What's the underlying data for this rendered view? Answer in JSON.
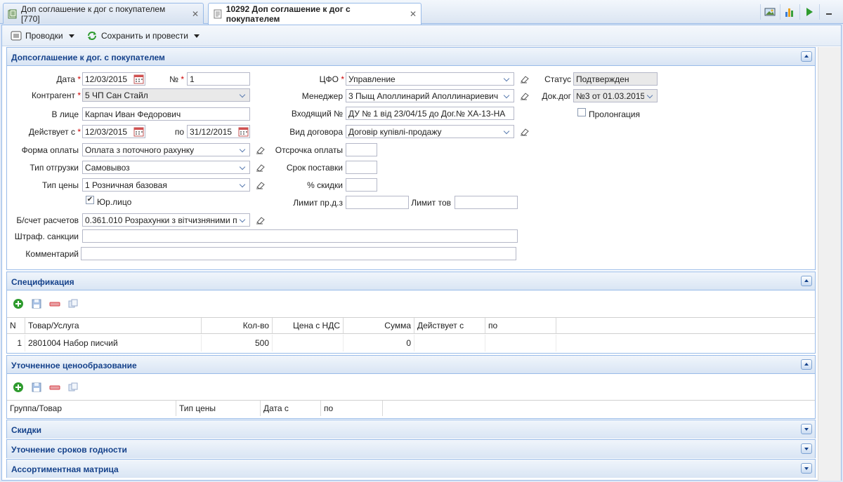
{
  "tabs": [
    {
      "label": "Доп соглашение к дог с покупателем [770]"
    },
    {
      "label": "10292 Доп соглашение к дог с покупателем"
    }
  ],
  "toolbar": {
    "postings": "Проводки",
    "save_post": "Сохранить и провести"
  },
  "main_section": {
    "title": "Допсоглашение к дог. с покупателем",
    "date_label": "Дата",
    "date_value": "12/03/2015",
    "num_label": "№",
    "num_value": "1",
    "cfo_label": "ЦФО",
    "cfo_value": "Управление",
    "status_label": "Статус",
    "status_value": "Подтвержден",
    "counterparty_label": "Контрагент",
    "counterparty_value": "5 ЧП Сан Стайл",
    "manager_label": "Менеджер",
    "manager_value": "3 Пыщ Аполлинарий Аполлинариевич",
    "contract_label": "Док.дог",
    "contract_value": "№3 от 01.03.2015",
    "person_label": "В лице",
    "person_value": "Карпач Иван Федорович",
    "incoming_label": "Входящий №",
    "incoming_value": "ДУ № 1 від 23/04/15 до Дог.№ ХА-13-НА",
    "prolong_label": "Пролонгация",
    "valid_from_label": "Действует с",
    "valid_from_value": "12/03/2015",
    "valid_to_label": "по",
    "valid_to_value": "31/12/2015",
    "contract_type_label": "Вид договора",
    "contract_type_value": "Договір купівлі-продажу",
    "payment_label": "Форма оплаты",
    "payment_value": "Оплата з поточного рахунку",
    "deferral_label": "Отсрочка оплаты",
    "deferral_value": "",
    "shipment_label": "Тип отгрузки",
    "shipment_value": "Самовывоз",
    "delivery_label": "Срок поставки",
    "delivery_value": "",
    "price_type_label": "Тип цены",
    "price_type_value": "1 Розничная базовая",
    "discount_label": "% скидки",
    "discount_value": "",
    "legal_label": "Юр.лицо",
    "limit_label": "Лимит пр.д.з",
    "limit_value": "",
    "limit_goods_label": "Лимит тов",
    "limit_goods_value": "",
    "account_label": "Б/счет расчетов",
    "account_value": "0.361.010 Розрахунки з вітчизняними п",
    "penalty_label": "Штраф. санкции",
    "penalty_value": "",
    "comment_label": "Комментарий",
    "comment_value": ""
  },
  "spec": {
    "title": "Спецификация",
    "columns": [
      "N",
      "Товар/Услуга",
      "Кол-во",
      "Цена с НДС",
      "Сумма",
      "Действует с",
      "по"
    ],
    "rows": [
      {
        "n": "1",
        "item": "2801004 Набор писчий",
        "qty": "500",
        "price": "",
        "sum": "0",
        "from": "",
        "to": ""
      }
    ]
  },
  "pricing": {
    "title": "Уточненное ценообразование",
    "columns": [
      "Группа/Товар",
      "Тип цены",
      "Дата с",
      "по"
    ]
  },
  "collapsed": {
    "discounts": "Скидки",
    "shelf_life": "Уточнение сроков годности",
    "assortment": "Ассортиментная матрица"
  },
  "colors": {
    "accent": "#15428b",
    "border": "#99bbe8",
    "add": "#2e9b2e",
    "delete": "#d9434a"
  },
  "icons": {
    "add": "plus-icon",
    "save": "save-icon",
    "delete": "delete-icon",
    "copy": "copy-icon",
    "calendar": "calendar-icon",
    "eraser": "eraser-icon"
  }
}
